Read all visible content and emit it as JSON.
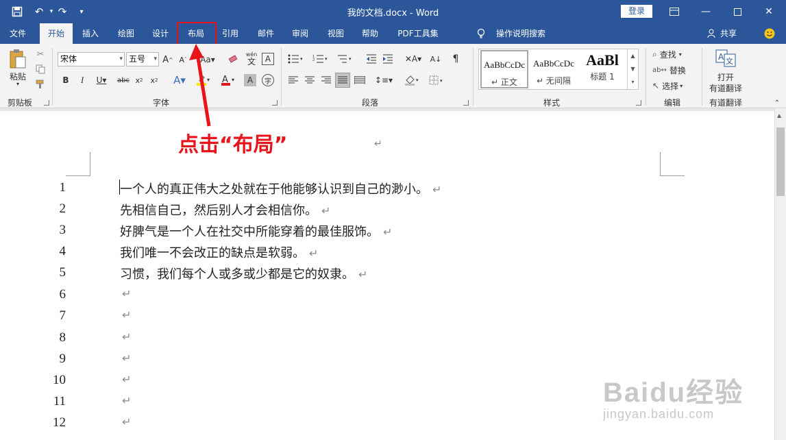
{
  "titlebar": {
    "doc_title": "我的文档.docx  -  Word",
    "login": "登录",
    "save_icon": "save-icon",
    "undo_icon": "undo-icon",
    "redo_icon": "redo-icon"
  },
  "tabs": [
    {
      "label": "文件"
    },
    {
      "label": "开始"
    },
    {
      "label": "插入"
    },
    {
      "label": "绘图"
    },
    {
      "label": "设计"
    },
    {
      "label": "布局"
    },
    {
      "label": "引用"
    },
    {
      "label": "邮件"
    },
    {
      "label": "审阅"
    },
    {
      "label": "视图"
    },
    {
      "label": "帮助"
    },
    {
      "label": "PDF工具集"
    }
  ],
  "tell_me": "操作说明搜索",
  "share": "共享",
  "ribbon": {
    "clipboard": {
      "paste": "粘贴",
      "label": "剪贴板"
    },
    "font": {
      "name": "宋体",
      "size": "五号",
      "label": "字体",
      "wen": "wén",
      "wen_char": "文"
    },
    "paragraph": {
      "label": "段落"
    },
    "styles": {
      "label": "样式",
      "items": [
        {
          "sample": "AaBbCcDc",
          "name": "正文"
        },
        {
          "sample": "AaBbCcDc",
          "name": "无间隔"
        },
        {
          "sample": "AaBl",
          "name": "标题 1"
        }
      ]
    },
    "editing": {
      "find": "查找",
      "replace": "替换",
      "select": "选择",
      "label": "编辑"
    },
    "translate": {
      "open": "打开",
      "doc_translate": "有道翻译",
      "label": "有道翻译"
    }
  },
  "annotation": "点击“布局”",
  "document": {
    "lines": [
      {
        "num": "1",
        "text": "一个人的真正伟大之处就在于他能够认识到自己的渺小。"
      },
      {
        "num": "2",
        "text": "先相信自己，然后别人才会相信你。"
      },
      {
        "num": "3",
        "text": "好脾气是一个人在社交中所能穿着的最佳服饰。"
      },
      {
        "num": "4",
        "text": "我们唯一不会改正的缺点是软弱。"
      },
      {
        "num": "5",
        "text": "习惯，我们每个人或多或少都是它的奴隶。"
      },
      {
        "num": "6",
        "text": ""
      },
      {
        "num": "7",
        "text": ""
      },
      {
        "num": "8",
        "text": ""
      },
      {
        "num": "9",
        "text": ""
      },
      {
        "num": "10",
        "text": ""
      },
      {
        "num": "11",
        "text": ""
      },
      {
        "num": "12",
        "text": ""
      }
    ],
    "para_mark": "↵"
  },
  "watermark": {
    "brand": "Baidu经验",
    "url": "jingyan.baidu.com"
  }
}
